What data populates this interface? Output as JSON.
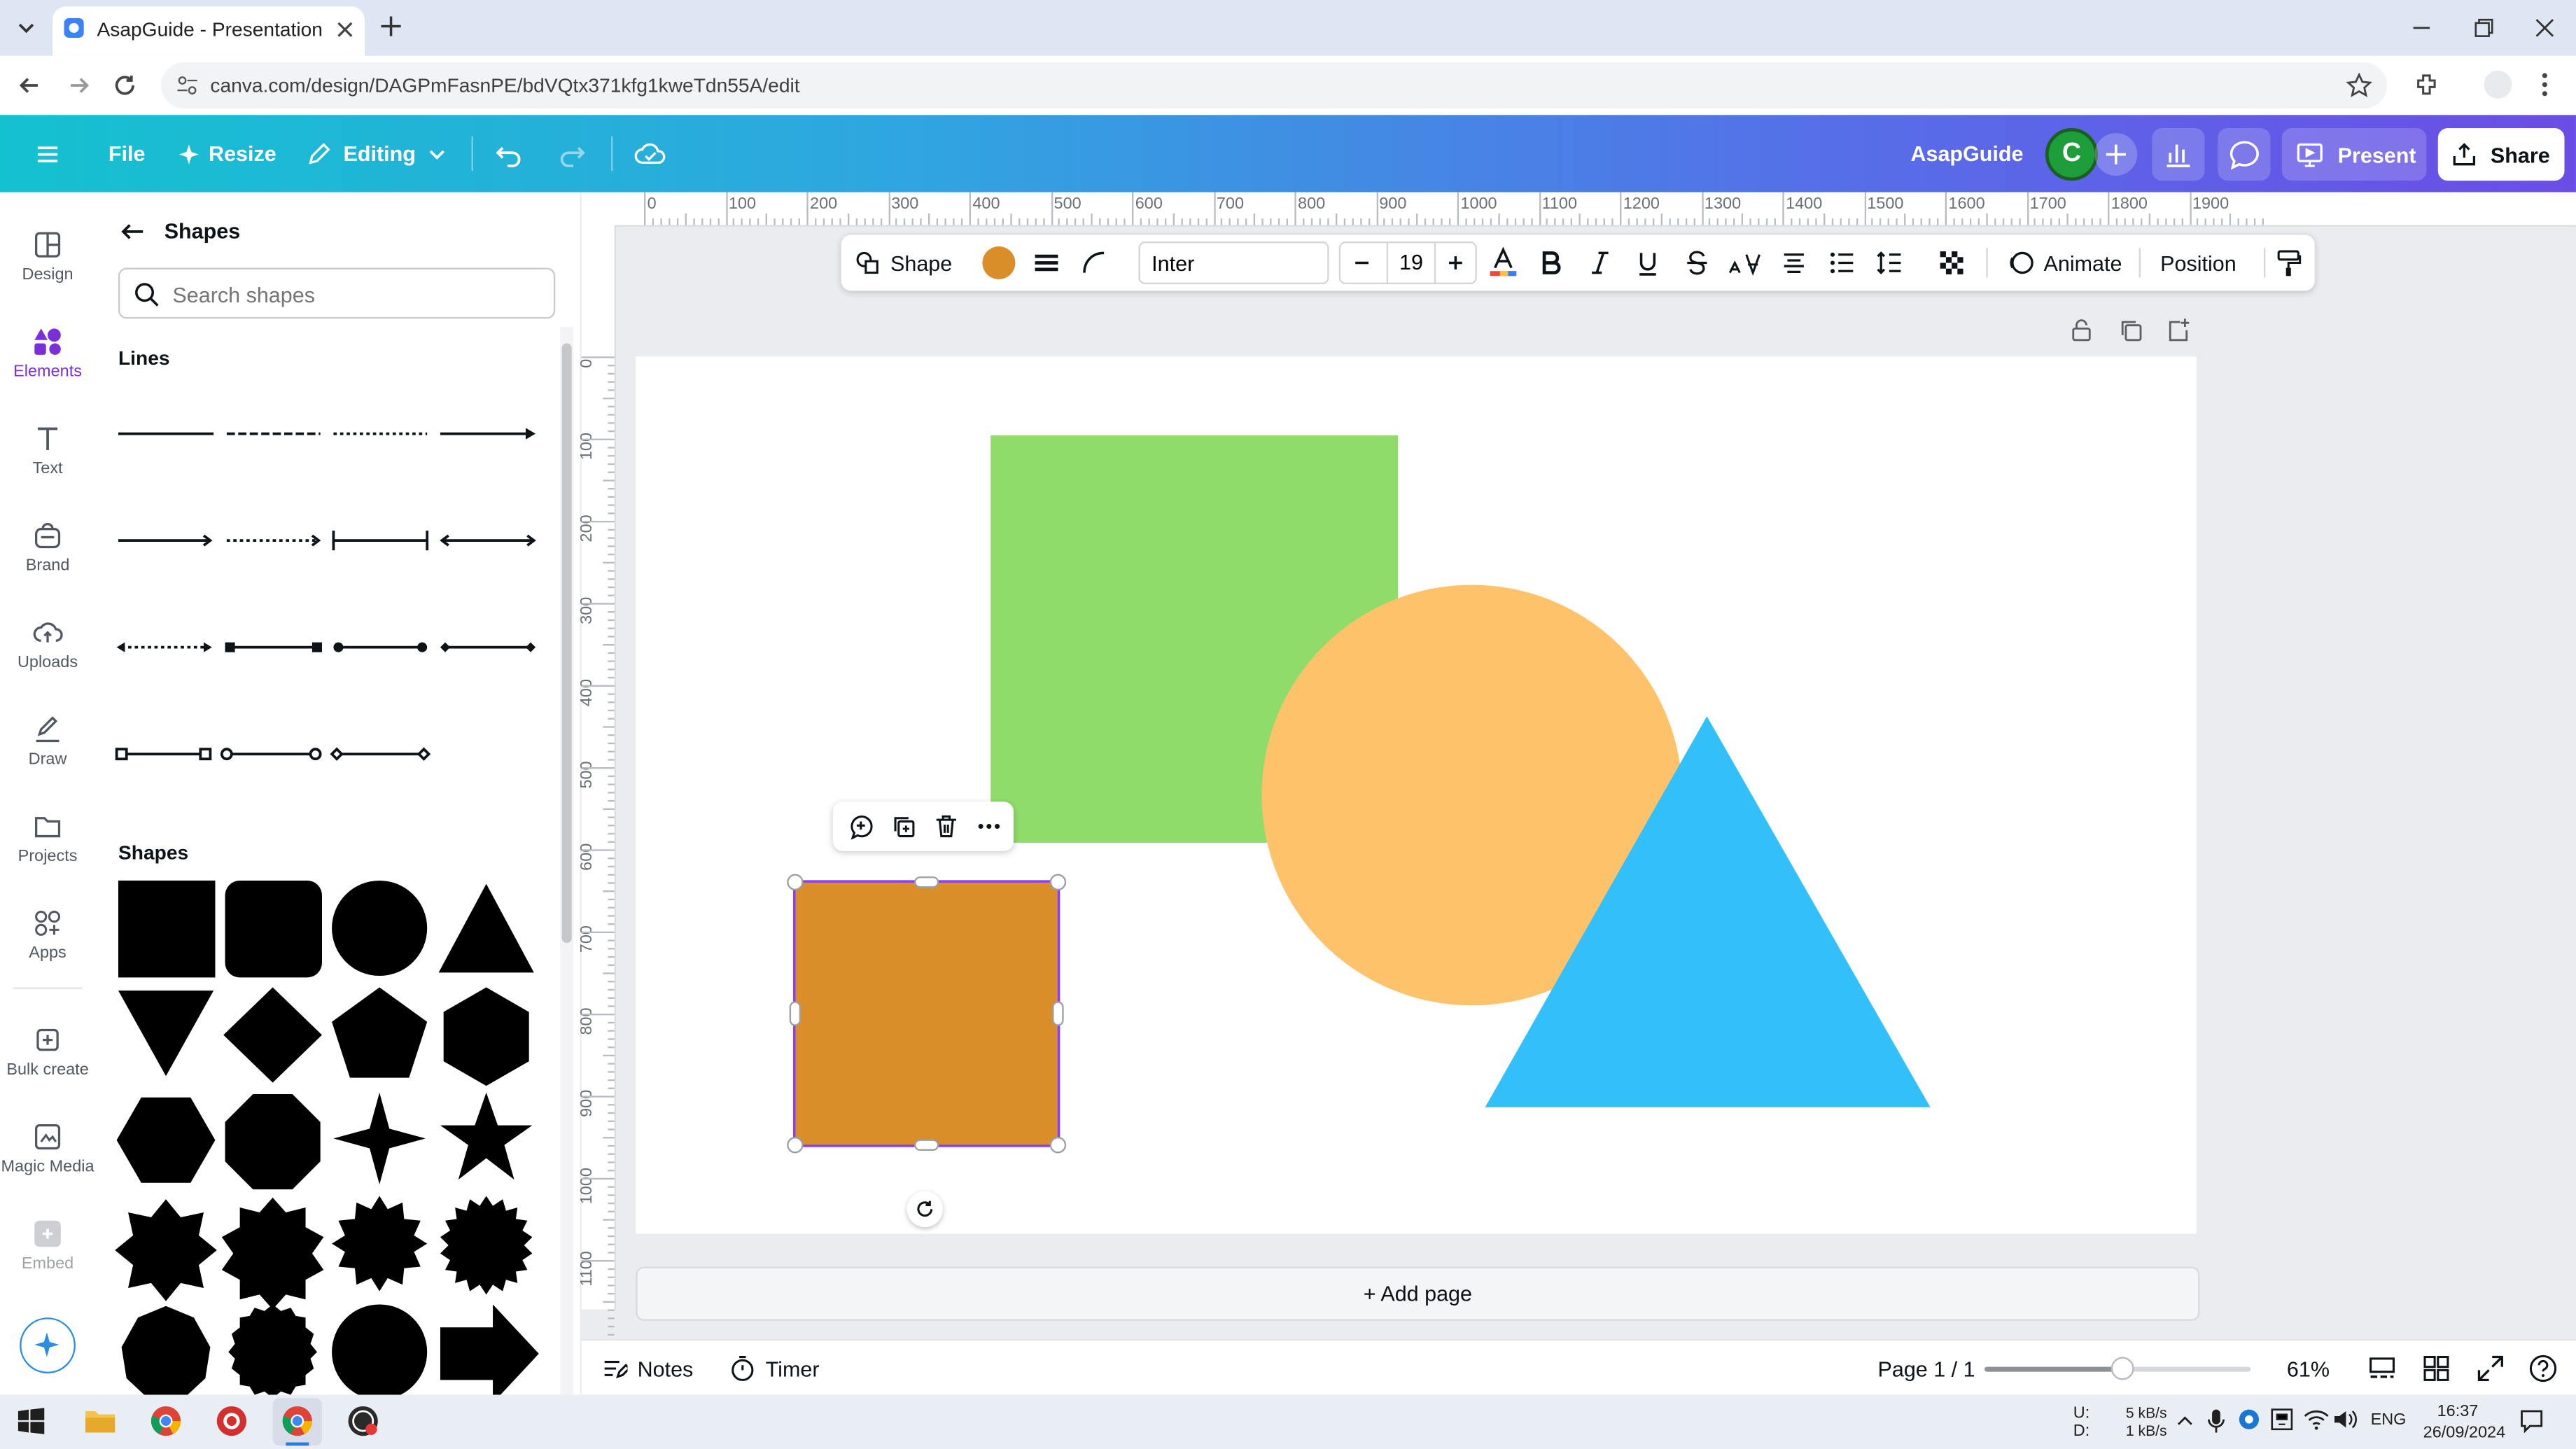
{
  "browser": {
    "tab_title": "AsapGuide - Presentation",
    "url": "canva.com/design/DAGPmFasnPE/bdVQtx371kfg1kweTdn55A/edit"
  },
  "header": {
    "file": "File",
    "resize": "Resize",
    "editing": "Editing",
    "team_name": "AsapGuide",
    "avatar_initial": "C",
    "present": "Present",
    "share": "Share"
  },
  "rail": {
    "design": "Design",
    "elements": "Elements",
    "text": "Text",
    "brand": "Brand",
    "uploads": "Uploads",
    "draw": "Draw",
    "projects": "Projects",
    "apps": "Apps",
    "bulk_create": "Bulk create",
    "magic_media": "Magic Media",
    "embed": "Embed"
  },
  "panel": {
    "title": "Shapes",
    "search_placeholder": "Search shapes",
    "lines_heading": "Lines",
    "shapes_heading": "Shapes"
  },
  "toolbar": {
    "shape": "Shape",
    "fill_color": "#d98e2a",
    "font": "Inter",
    "font_size": "19",
    "animate": "Animate",
    "position": "Position"
  },
  "rulers": {
    "top": [
      "0",
      "100",
      "200",
      "300",
      "400",
      "500",
      "600",
      "700",
      "800",
      "900",
      "1000",
      "1100",
      "1200",
      "1300",
      "1400",
      "1500",
      "1600",
      "1700",
      "1800",
      "1900"
    ],
    "left": [
      "0",
      "100",
      "200",
      "300",
      "400",
      "500",
      "600",
      "700",
      "800",
      "900",
      "1000",
      "1100"
    ]
  },
  "canvas": {
    "add_page": "+ Add page",
    "colors": {
      "square": "#90dc6b",
      "circle": "#fec26b",
      "triangle": "#33c0fa",
      "selected": "#d98e2a"
    }
  },
  "bottom": {
    "notes": "Notes",
    "timer": "Timer",
    "page_indicator": "Page 1 / 1",
    "zoom": "61%",
    "zoom_level": 0.61
  },
  "taskbar": {
    "net_up_label": "U:",
    "net_down_label": "D:",
    "net_up": "5 kB/s",
    "net_down": "1 kB/s",
    "language": "ENG",
    "time": "16:37",
    "date": "26/09/2024"
  }
}
